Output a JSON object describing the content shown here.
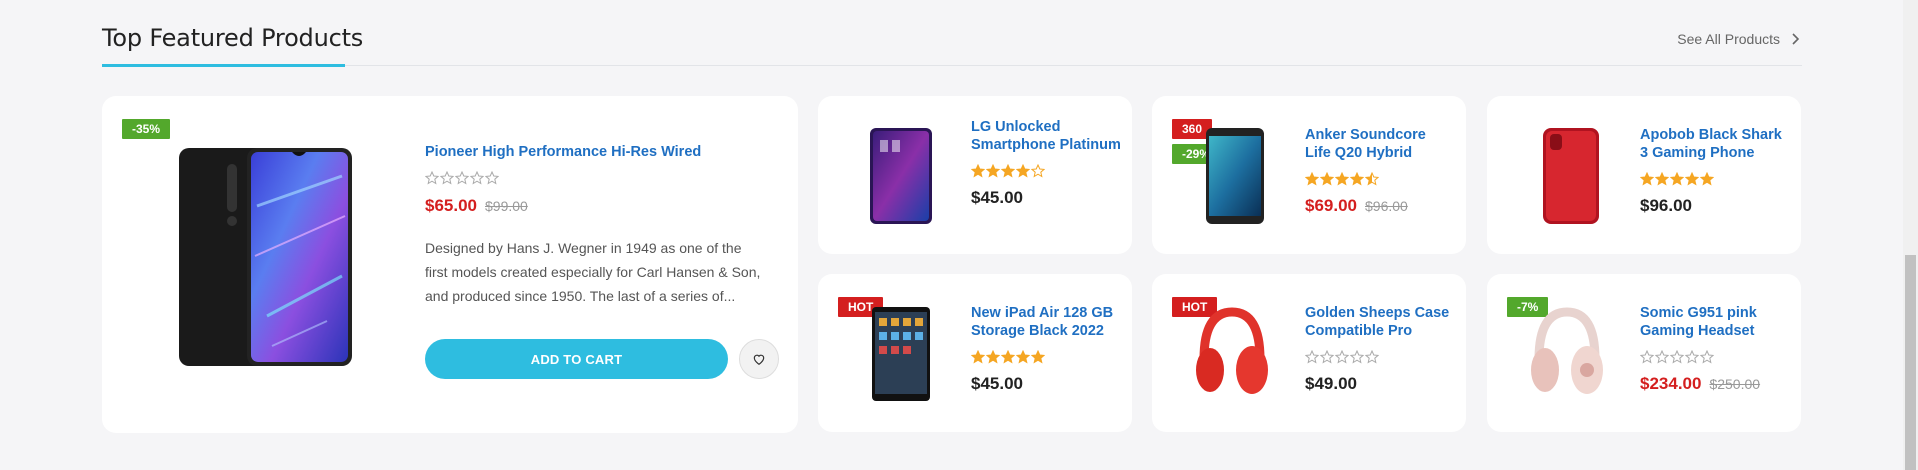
{
  "section": {
    "title": "Top Featured Products",
    "see_all": "See All Products",
    "accent_color": "#2ebde0"
  },
  "featured": {
    "badge": "-35%",
    "name": "Pioneer High Performance Hi-Res Wired",
    "rating": 0,
    "price": "$65.00",
    "old_price": "$99.00",
    "description": "Designed by Hans J. Wegner in 1949 as one of the first models created especially for Carl Hansen & Son, and produced since 1950. The last of a series of...",
    "add_to_cart": "ADD TO CART",
    "wishlist_icon": "heart-icon"
  },
  "products": [
    {
      "name": "LG Unlocked Smartphone Platinum",
      "badges": [],
      "rating": 4,
      "price": "$45.00",
      "old_price": "",
      "sale": false
    },
    {
      "name": "Anker Soundcore Life Q20 Hybrid",
      "badges": [
        "360",
        "-29%"
      ],
      "rating": 4.5,
      "price": "$69.00",
      "old_price": "$96.00",
      "sale": true
    },
    {
      "name": "Apobob Black Shark 3 Gaming Phone",
      "badges": [],
      "rating": 5,
      "price": "$96.00",
      "old_price": "",
      "sale": false
    },
    {
      "name": "New iPad Air 128 GB Storage Black 2022",
      "badges": [
        "HOT"
      ],
      "rating": 5,
      "price": "$45.00",
      "old_price": "",
      "sale": false
    },
    {
      "name": "Golden Sheeps Case Compatible Pro",
      "badges": [
        "HOT"
      ],
      "rating": 0,
      "price": "$49.00",
      "old_price": "",
      "sale": false
    },
    {
      "name": "Somic G951 pink Gaming Headset",
      "badges": [
        "-7%"
      ],
      "rating": 0,
      "price": "$234.00",
      "old_price": "$250.00",
      "sale": true
    }
  ]
}
